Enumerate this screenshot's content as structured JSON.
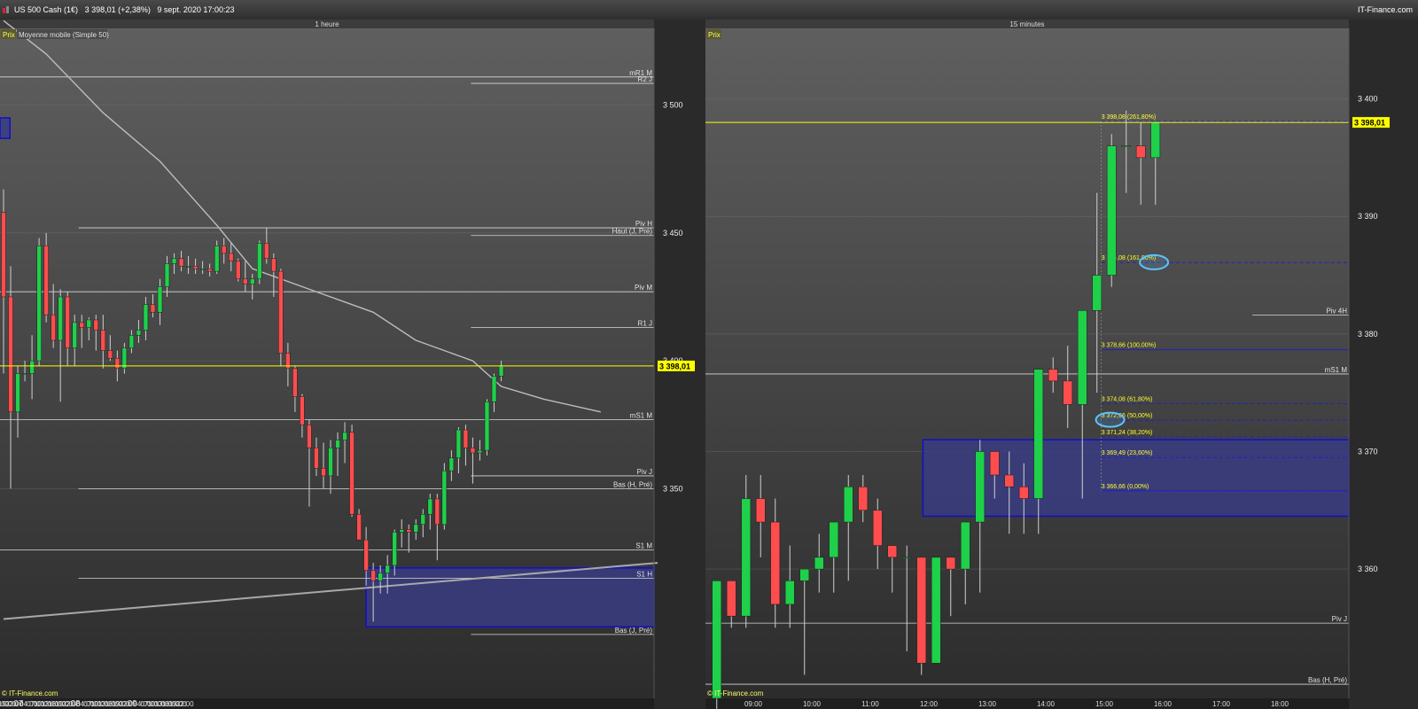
{
  "header": {
    "instrument": "US 500 Cash (1€)",
    "last": "3 398,01 (+2,38%)",
    "datetime": "9 sept. 2020 17:00:23",
    "site": "IT-Finance.com"
  },
  "colors": {
    "up": "#1fd04a",
    "down": "#ff4d4d",
    "price_line": "#ffff00",
    "zone_fill": "#3a3c86",
    "zone_border": "#1010c8",
    "fib_line": "#2020c8"
  },
  "left_chart": {
    "timeframe": "1 heure",
    "tag_price": "Prix",
    "tag_ma": "Moyenne mobile (Simple 50)",
    "watermark": "© IT-Finance.com",
    "last_label": "3 398,01",
    "y_ticks": [
      {
        "v": 3500,
        "t": "3 500"
      },
      {
        "v": 3450,
        "t": "3 450"
      },
      {
        "v": 3400,
        "t": "3 400"
      },
      {
        "v": 3350,
        "t": "3 350"
      }
    ],
    "x_ticks": [
      {
        "i": 0,
        "t": "16:00"
      },
      {
        "i": 1,
        "t": "19:00"
      },
      {
        "i": 2,
        "t": "22:00"
      },
      {
        "i": 2.6,
        "t": "07"
      },
      {
        "i": 4,
        "t": "04:00"
      },
      {
        "i": 5,
        "t": "07:00"
      },
      {
        "i": 6,
        "t": "10:00"
      },
      {
        "i": 7,
        "t": "13:00"
      },
      {
        "i": 8,
        "t": "16:00"
      },
      {
        "i": 9,
        "t": "19:00"
      },
      {
        "i": 10,
        "t": "22:00"
      },
      {
        "i": 10.6,
        "t": "08"
      },
      {
        "i": 12,
        "t": "04:00"
      },
      {
        "i": 13,
        "t": "07:00"
      },
      {
        "i": 14,
        "t": "10:00"
      },
      {
        "i": 15,
        "t": "13:00"
      },
      {
        "i": 16,
        "t": "16:00"
      },
      {
        "i": 17,
        "t": "19:00"
      },
      {
        "i": 18,
        "t": "22:00"
      },
      {
        "i": 18.6,
        "t": "09"
      },
      {
        "i": 20,
        "t": "04:00"
      },
      {
        "i": 21,
        "t": "07:00"
      },
      {
        "i": 22,
        "t": "10:00"
      },
      {
        "i": 23,
        "t": "13:00"
      },
      {
        "i": 24,
        "t": "16:00"
      },
      {
        "i": 25,
        "t": "19:00"
      },
      {
        "i": 26,
        "t": "22:00"
      }
    ],
    "levels": [
      {
        "label": "mR1 M",
        "price": 3511,
        "from": 0,
        "color": "#d8d8d8"
      },
      {
        "label": "R2 J",
        "price": 3508.5,
        "from": 0.72,
        "color": "#d8d8d8"
      },
      {
        "label": "Piv H",
        "price": 3452,
        "from": 0.12,
        "color": "#d8d8d8"
      },
      {
        "label": "Haut (J, Pré)",
        "price": 3449,
        "from": 0.72,
        "color": "#d8d8d8"
      },
      {
        "label": "Piv M",
        "price": 3427,
        "from": 0,
        "color": "#d8d8d8"
      },
      {
        "label": "R1 J",
        "price": 3413,
        "from": 0.72,
        "color": "#d8d8d8"
      },
      {
        "label": "mS1 M",
        "price": 3377,
        "from": 0,
        "color": "#d8d8d8"
      },
      {
        "label": "Piv J",
        "price": 3355,
        "from": 0.72,
        "color": "#d8d8d8"
      },
      {
        "label": "Bas (H, Pré)",
        "price": 3350,
        "from": 0.12,
        "color": "#d8d8d8"
      },
      {
        "label": "S1 M",
        "price": 3326,
        "from": 0,
        "color": "#d8d8d8"
      },
      {
        "label": "S1 H",
        "price": 3315,
        "from": 0.12,
        "color": "#d8d8d8"
      },
      {
        "label": "Bas (J, Pré)",
        "price": 3293,
        "from": 0.72,
        "color": "#d8d8d8"
      }
    ],
    "candles": [
      [
        3458,
        3467,
        3395,
        3425
      ],
      [
        3425,
        3437,
        3350,
        3380
      ],
      [
        3380,
        3398,
        3370,
        3395
      ],
      [
        3395,
        3400,
        3392,
        3395
      ],
      [
        3395,
        3410,
        3385,
        3400
      ],
      [
        3400,
        3448,
        3398,
        3445
      ],
      [
        3445,
        3450,
        3415,
        3418
      ],
      [
        3418,
        3430,
        3405,
        3408
      ],
      [
        3408,
        3428,
        3384,
        3425
      ],
      [
        3425,
        3427,
        3398,
        3405
      ],
      [
        3405,
        3418,
        3398,
        3415
      ],
      [
        3415,
        3418,
        3405,
        3413
      ],
      [
        3413,
        3417,
        3408,
        3416
      ],
      [
        3416,
        3418,
        3404,
        3412
      ],
      [
        3412,
        3418,
        3397,
        3404
      ],
      [
        3404,
        3410,
        3400,
        3401
      ],
      [
        3401,
        3404,
        3392,
        3397
      ],
      [
        3397,
        3407,
        3395,
        3405
      ],
      [
        3405,
        3412,
        3403,
        3410
      ],
      [
        3410,
        3416,
        3407,
        3412
      ],
      [
        3412,
        3425,
        3408,
        3422
      ],
      [
        3422,
        3426,
        3417,
        3419
      ],
      [
        3419,
        3432,
        3414,
        3429
      ],
      [
        3429,
        3441,
        3425,
        3438
      ],
      [
        3438,
        3442,
        3434,
        3440
      ],
      [
        3440,
        3443,
        3435,
        3437
      ],
      [
        3437,
        3441,
        3434,
        3437
      ],
      [
        3437,
        3440,
        3434,
        3436
      ],
      [
        3436,
        3439,
        3434,
        3436
      ],
      [
        3436,
        3438,
        3433,
        3435
      ],
      [
        3435,
        3447,
        3434,
        3445
      ],
      [
        3445,
        3448,
        3438,
        3442
      ],
      [
        3442,
        3446,
        3435,
        3439
      ],
      [
        3439,
        3440,
        3431,
        3432
      ],
      [
        3432,
        3439,
        3427,
        3430
      ],
      [
        3430,
        3434,
        3424,
        3432
      ],
      [
        3432,
        3447,
        3430,
        3446
      ],
      [
        3446,
        3452,
        3438,
        3440
      ],
      [
        3440,
        3442,
        3425,
        3435
      ],
      [
        3435,
        3436,
        3398,
        3403
      ],
      [
        3403,
        3407,
        3390,
        3397
      ],
      [
        3397,
        3398,
        3380,
        3386
      ],
      [
        3386,
        3387,
        3370,
        3375
      ],
      [
        3375,
        3377,
        3343,
        3366
      ],
      [
        3366,
        3370,
        3355,
        3358
      ],
      [
        3358,
        3368,
        3350,
        3355
      ],
      [
        3355,
        3369,
        3348,
        3366
      ],
      [
        3366,
        3372,
        3355,
        3369
      ],
      [
        3369,
        3376,
        3360,
        3372
      ],
      [
        3372,
        3375,
        3339,
        3340
      ],
      [
        3340,
        3342,
        3330,
        3330
      ],
      [
        3330,
        3335,
        3312,
        3318
      ],
      [
        3318,
        3321,
        3298,
        3314
      ],
      [
        3314,
        3320,
        3309,
        3317
      ],
      [
        3317,
        3324,
        3309,
        3320
      ],
      [
        3320,
        3334,
        3316,
        3333
      ],
      [
        3333,
        3338,
        3327,
        3334
      ],
      [
        3334,
        3336,
        3325,
        3333
      ],
      [
        3333,
        3338,
        3330,
        3336
      ],
      [
        3336,
        3342,
        3331,
        3340
      ],
      [
        3340,
        3348,
        3334,
        3346
      ],
      [
        3346,
        3348,
        3322,
        3336
      ],
      [
        3336,
        3360,
        3334,
        3357
      ],
      [
        3357,
        3365,
        3353,
        3362
      ],
      [
        3362,
        3374,
        3356,
        3373
      ],
      [
        3373,
        3375,
        3359,
        3366
      ],
      [
        3366,
        3370,
        3352,
        3364
      ],
      [
        3364,
        3369,
        3361,
        3365
      ],
      [
        3365,
        3385,
        3363,
        3384
      ],
      [
        3384,
        3395,
        3380,
        3394
      ],
      [
        3394,
        3400,
        3392,
        3398
      ]
    ],
    "ma50": [
      [
        0,
        3533
      ],
      [
        6,
        3520
      ],
      [
        14,
        3497
      ],
      [
        22,
        3478
      ],
      [
        30,
        3453
      ],
      [
        35,
        3436
      ],
      [
        45,
        3426
      ],
      [
        52,
        3419
      ],
      [
        58,
        3408
      ],
      [
        66,
        3400
      ],
      [
        70,
        3390
      ],
      [
        76,
        3385
      ],
      [
        84,
        3380
      ]
    ],
    "trend": [
      [
        0,
        3299
      ],
      [
        92,
        3321
      ]
    ],
    "zones": [
      {
        "x0": 0,
        "x1": 1.4,
        "top": 3495,
        "bottom": 3487
      },
      {
        "x0": 51.5,
        "x1": 92,
        "top": 3319,
        "bottom": 3296
      }
    ],
    "y_min": 3268,
    "y_max": 3530,
    "n_slots": 92
  },
  "right_chart": {
    "timeframe": "15 minutes",
    "tag_price": "Prix",
    "watermark": "© IT-Finance.com",
    "last_label": "3 398,01",
    "y_ticks": [
      {
        "v": 3400,
        "t": "3 400"
      },
      {
        "v": 3390,
        "t": "3 390"
      },
      {
        "v": 3380,
        "t": "3 380"
      },
      {
        "v": 3370,
        "t": "3 370"
      },
      {
        "v": 3360,
        "t": "3 360"
      }
    ],
    "x_ticks": [
      {
        "i": 3,
        "t": "09:00"
      },
      {
        "i": 7,
        "t": "10:00"
      },
      {
        "i": 11,
        "t": "11:00"
      },
      {
        "i": 15,
        "t": "12:00"
      },
      {
        "i": 19,
        "t": "13:00"
      },
      {
        "i": 23,
        "t": "14:00"
      },
      {
        "i": 27,
        "t": "15:00"
      },
      {
        "i": 31,
        "t": "16:00"
      },
      {
        "i": 35,
        "t": "17:00"
      },
      {
        "i": 39,
        "t": "18:00"
      }
    ],
    "levels": [
      {
        "label": "mS1 M",
        "price": 3376.6,
        "from": 0,
        "color": "#d8d8d8"
      },
      {
        "label": "Piv 4H",
        "price": 3381.6,
        "from": 0.85,
        "color": "#d8d8d8"
      },
      {
        "label": "Piv J",
        "price": 3355.4,
        "from": 0,
        "color": "#d8d8d8"
      },
      {
        "label": "Bas (H, Pré)",
        "price": 3350.2,
        "from": 0,
        "color": "#d8d8d8"
      }
    ],
    "fibs": [
      {
        "label": "3 398,08 (261,80%)",
        "price": 3398.08,
        "dashed": true
      },
      {
        "label": "3 386,08 (161,80%)",
        "price": 3386.08,
        "dashed": true
      },
      {
        "label": "3 378,66 (100,00%)",
        "price": 3378.66,
        "dashed": false
      },
      {
        "label": "3 374,08 (61,80%)",
        "price": 3374.08,
        "dashed": true
      },
      {
        "label": "3 372,66 (50,00%)",
        "price": 3372.66,
        "dashed": true
      },
      {
        "label": "3 371,24 (38,20%)",
        "price": 3371.24,
        "dashed": true
      },
      {
        "label": "3 369,49 (23,60%)",
        "price": 3369.49,
        "dashed": true
      },
      {
        "label": "3 366,66 (0,00%)",
        "price": 3366.66,
        "dashed": false
      }
    ],
    "candles": [
      [
        3349,
        3359,
        3347,
        3359
      ],
      [
        3359,
        3359,
        3355,
        3356
      ],
      [
        3356,
        3368,
        3355,
        3366
      ],
      [
        3366,
        3368,
        3361,
        3364
      ],
      [
        3364,
        3366,
        3355,
        3357
      ],
      [
        3357,
        3362,
        3355,
        3359
      ],
      [
        3359,
        3360,
        3351,
        3360
      ],
      [
        3360,
        3363,
        3358,
        3361
      ],
      [
        3361,
        3364,
        3358,
        3364
      ],
      [
        3364,
        3368,
        3359,
        3367
      ],
      [
        3367,
        3368,
        3364,
        3365
      ],
      [
        3365,
        3366,
        3360,
        3362
      ],
      [
        3362,
        3362,
        3358,
        3361
      ],
      [
        3361,
        3362,
        3353,
        3361
      ],
      [
        3361,
        3361,
        3351,
        3352
      ],
      [
        3352,
        3361,
        3352,
        3361
      ],
      [
        3361,
        3361,
        3356,
        3360
      ],
      [
        3360,
        3363,
        3357,
        3364
      ],
      [
        3364,
        3371,
        3358,
        3370
      ],
      [
        3370,
        3370,
        3366,
        3368
      ],
      [
        3368,
        3370,
        3363,
        3367
      ],
      [
        3367,
        3369,
        3363,
        3366
      ],
      [
        3366,
        3377,
        3363,
        3377
      ],
      [
        3377,
        3378,
        3375,
        3376
      ],
      [
        3376,
        3379,
        3372,
        3374
      ],
      [
        3374,
        3380,
        3366,
        3382
      ],
      [
        3382,
        3392,
        3375,
        3385
      ],
      [
        3385,
        3397,
        3384,
        3396
      ],
      [
        3396,
        3399,
        3392,
        3396
      ],
      [
        3396,
        3398,
        3391,
        3395
      ],
      [
        3395,
        3398,
        3391,
        3398
      ]
    ],
    "zone": {
      "x0": 14.6,
      "x1": 44,
      "top": 3371,
      "bottom": 3364.5
    },
    "fib_x0": 26.8,
    "ellipses": [
      {
        "i": 29.9,
        "p": 3386.1
      },
      {
        "i": 26.9,
        "p": 3372.7
      }
    ],
    "y_min": 3349,
    "y_max": 3406,
    "x_start": 4.5,
    "n_slots": 44
  }
}
